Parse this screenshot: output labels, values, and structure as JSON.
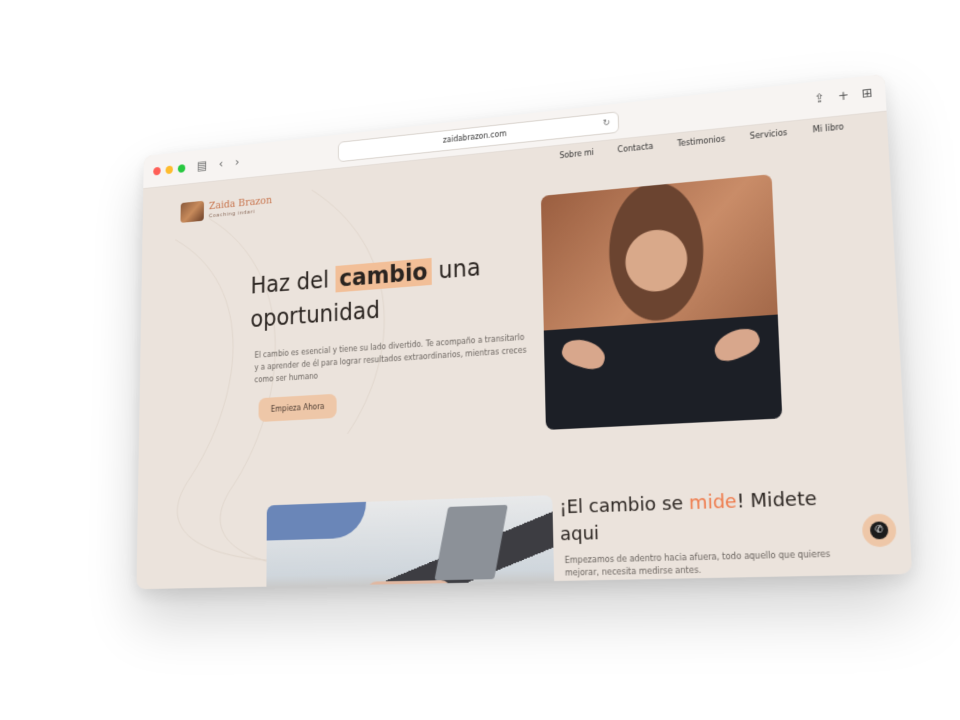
{
  "browser": {
    "url": "zaidabrazon.com"
  },
  "nav": {
    "items": [
      "Sobre mi",
      "Contacta",
      "Testimonios",
      "Servicios",
      "Mi libro"
    ]
  },
  "logo": {
    "name": "Zaida Brazon",
    "tagline": "Coaching indari"
  },
  "hero": {
    "title_before": "Haz del ",
    "title_highlight": "cambio",
    "title_after": " una",
    "title_line2": "oportunidad",
    "description": "El cambio es esencial y tiene su lado divertido. Te acompaño a transitarlo y a aprender de él para lograr resultados extraordinarios, mientras creces como ser humano",
    "cta_label": "Empieza Ahora"
  },
  "section2": {
    "title_before": "¡El cambio se ",
    "title_accent": "mide",
    "title_after": "! Midete",
    "title_line2": "aqui",
    "description": "Empezamos de adentro hacia afuera, todo aquello que quieres mejorar, necesita medirse antes."
  },
  "colors": {
    "background": "#ebe3dc",
    "highlight": "#f2bf98",
    "accent": "#ef7a4a",
    "button": "#eec7a8"
  }
}
